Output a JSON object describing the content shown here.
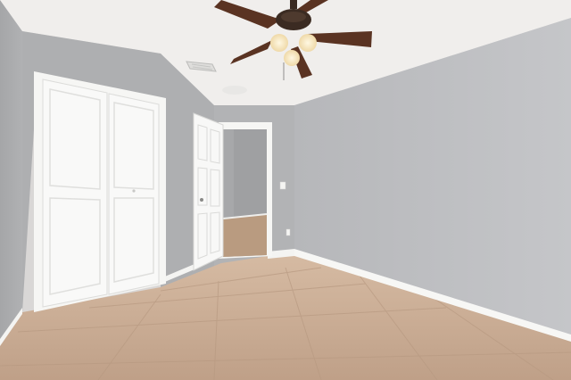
{
  "scene": {
    "subject": "empty-bedroom-interior",
    "colors": {
      "ceiling": "#f1efee",
      "wall_left": "#a9aaab",
      "wall_back": "#b3b4b6",
      "wall_right": "#c0c1c4",
      "floor": "#c9ab91",
      "trim": "#f7f7f5",
      "fan_wood": "#5b3424",
      "fan_metal": "#3a2a22",
      "light_glass": "#f7e9c8"
    },
    "icons": [
      "ceiling-fan-icon",
      "air-vent-icon",
      "light-switch-icon"
    ]
  }
}
